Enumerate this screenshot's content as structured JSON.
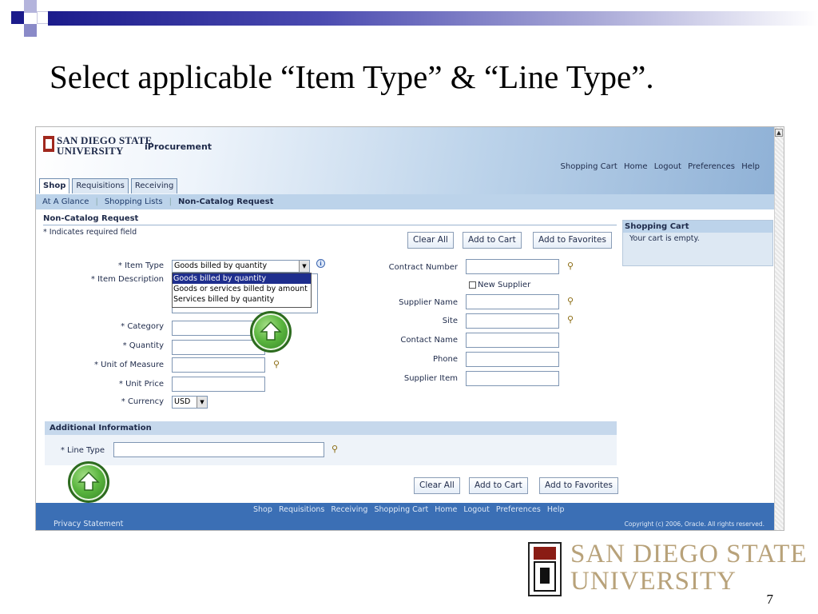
{
  "slide": {
    "title": "Select applicable “Item Type” & “Line Type”.",
    "page_number": "7",
    "logo_line1": "SAN DIEGO STATE",
    "logo_line2": "UNIVERSITY"
  },
  "app": {
    "logo_line1": "SAN DIEGO STATE",
    "logo_line2": "UNIVERSITY",
    "name": "iProcurement",
    "global_links": [
      "Shopping Cart",
      "Home",
      "Logout",
      "Preferences",
      "Help"
    ],
    "tabs": [
      "Shop",
      "Requisitions",
      "Receiving"
    ],
    "subnav": [
      "At A Glance",
      "Shopping Lists",
      "Non-Catalog Request"
    ]
  },
  "form": {
    "section_title": "Non-Catalog Request",
    "required_note": "* Indicates required field",
    "buttons": {
      "clear_all": "Clear All",
      "add_to_cart": "Add to Cart",
      "add_to_favorites": "Add to Favorites"
    },
    "labels": {
      "item_type": "* Item Type",
      "item_description": "* Item Description",
      "category": "* Category",
      "quantity": "* Quantity",
      "unit_of_measure": "* Unit of Measure",
      "unit_price": "* Unit Price",
      "currency": "* Currency",
      "contract_number": "Contract Number",
      "new_supplier": "New Supplier",
      "supplier_name": "Supplier Name",
      "site": "Site",
      "contact_name": "Contact Name",
      "phone": "Phone",
      "supplier_item": "Supplier Item"
    },
    "item_type_value": "Goods billed by quantity",
    "item_type_options": [
      "Goods billed by quantity",
      "Goods or services billed by amount",
      "Services billed by quantity"
    ],
    "currency_value": "USD"
  },
  "cart": {
    "title": "Shopping Cart",
    "message": "Your cart is empty."
  },
  "additional_info": {
    "title": "Additional Information",
    "line_type_label": "* Line Type"
  },
  "footer": {
    "links": [
      "Shop",
      "Requisitions",
      "Receiving",
      "Shopping Cart",
      "Home",
      "Logout",
      "Preferences",
      "Help"
    ],
    "privacy": "Privacy Statement",
    "copyright": "Copyright (c) 2006, Oracle. All rights reserved."
  }
}
